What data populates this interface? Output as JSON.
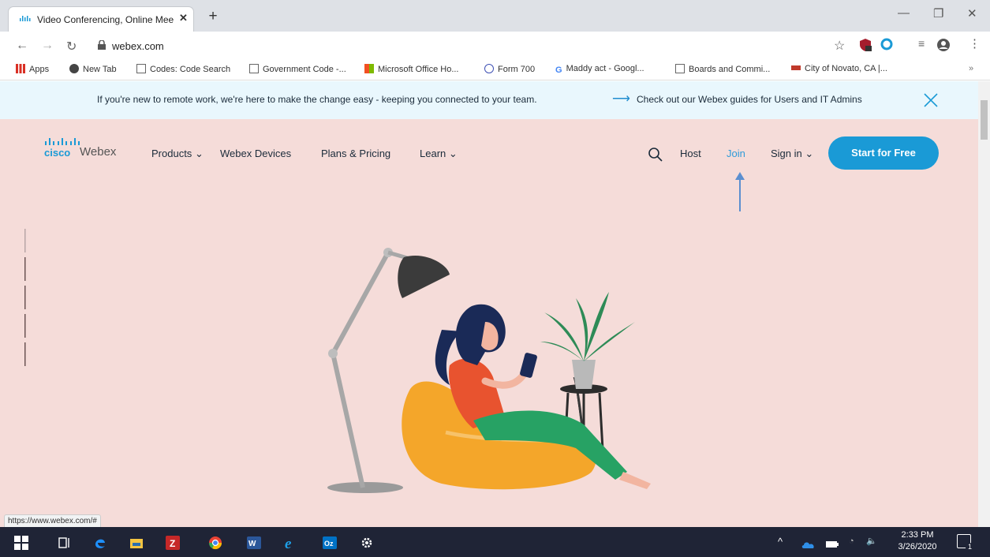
{
  "browser": {
    "tab_title": "Video Conferencing, Online Mee",
    "tab_close": "✕",
    "new_tab": "+",
    "url": "webex.com",
    "min": "—",
    "restore": "❐",
    "close": "✕"
  },
  "bookmarks": [
    {
      "label": "Apps",
      "icon": "apps-grid-icon"
    },
    {
      "label": "New Tab",
      "icon": "chrome-icon"
    },
    {
      "label": "Codes: Code Search",
      "icon": "building-icon"
    },
    {
      "label": "Government Code -...",
      "icon": "building-icon"
    },
    {
      "label": "Microsoft Office Ho...",
      "icon": "office-icon"
    },
    {
      "label": "Form 700",
      "icon": "form-icon"
    },
    {
      "label": "Maddy act - Googl...",
      "icon": "google-icon"
    },
    {
      "label": "Boards and Commi...",
      "icon": "building-icon"
    },
    {
      "label": "City of Novato, CA |...",
      "icon": "novato-icon"
    }
  ],
  "bookmarks_more": "»",
  "banner": {
    "text": "If you're new to remote work, we're here to make the change easy - keeping you connected to your team.",
    "link": "Check out our Webex guides for Users and IT Admins"
  },
  "logo": {
    "cisco": "cisco",
    "product": "Webex"
  },
  "nav": {
    "products": "Products",
    "devices": "Webex Devices",
    "plans": "Plans & Pricing",
    "learn": "Learn",
    "host": "Host",
    "join": "Join",
    "signin": "Sign in",
    "start": "Start for Free"
  },
  "status_url": "https://www.webex.com/#",
  "tray": {
    "time": "2:33 PM",
    "date": "3/26/2020",
    "notif_count": "1"
  },
  "colors": {
    "page_bg": "#f5dcd9",
    "banner_bg": "#e9f7fd",
    "accent": "#1a9ad6",
    "taskbar": "#1f2436"
  }
}
